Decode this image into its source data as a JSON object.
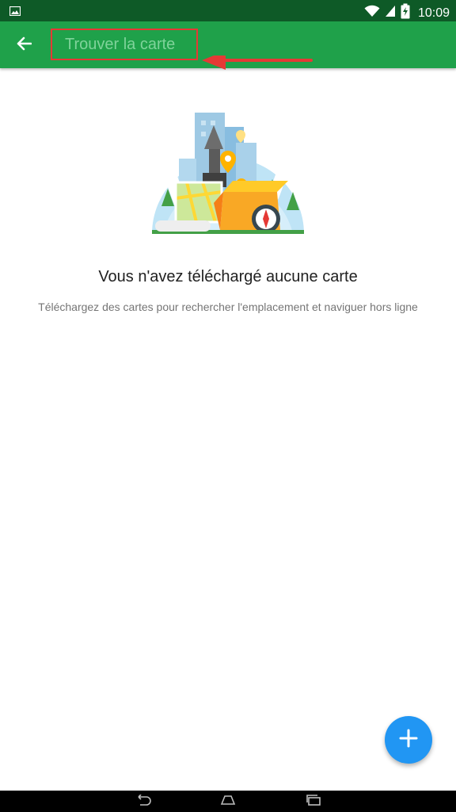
{
  "status_bar": {
    "time": "10:09",
    "icons": [
      "image-icon",
      "wifi-icon",
      "signal-icon",
      "battery-charging-icon"
    ]
  },
  "app_bar": {
    "background": "#1fa14a",
    "back_icon": "arrow-back-icon",
    "search_placeholder": "Trouver la carte",
    "search_value": ""
  },
  "annotation": {
    "color": "#e53935",
    "shape": "red box with arrow pointing at search field"
  },
  "empty_state": {
    "illustration": "maps-illustration",
    "title": "Vous n'avez téléchargé aucune carte",
    "description": "Téléchargez des cartes pour rechercher l'emplacement et naviguer hors ligne"
  },
  "fab": {
    "icon": "plus-icon",
    "color": "#2196f3"
  },
  "nav_bar": {
    "icons": [
      "back-nav-icon",
      "home-nav-icon",
      "recents-nav-icon"
    ]
  }
}
